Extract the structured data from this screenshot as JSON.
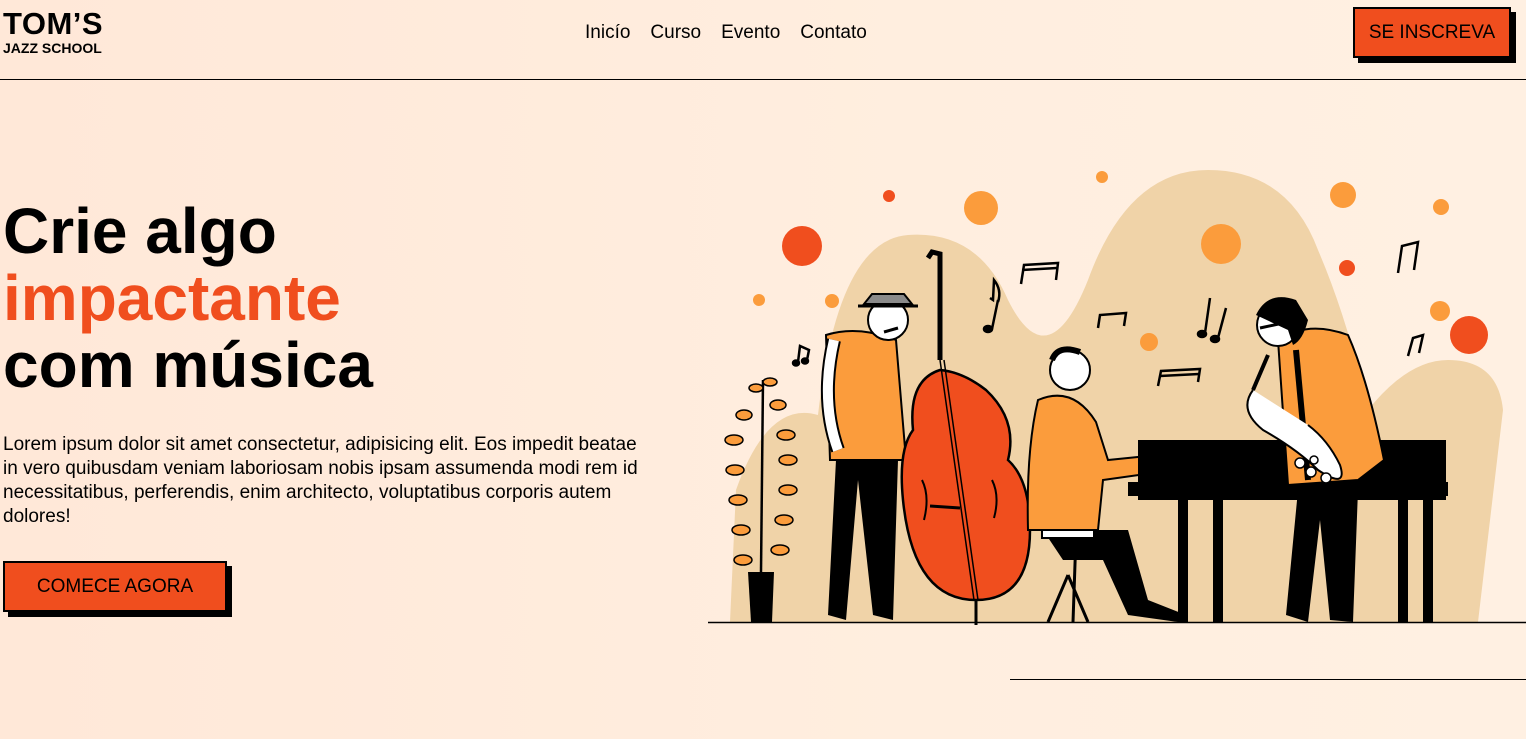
{
  "header": {
    "logo": {
      "line1": "TOM’S",
      "line2": "JAZZ SCHOOL"
    },
    "nav": [
      {
        "label": "Inicío"
      },
      {
        "label": "Curso"
      },
      {
        "label": "Evento"
      },
      {
        "label": "Contato"
      }
    ],
    "signup_label": "SE INSCREVA"
  },
  "hero": {
    "title_line1": "Crie algo",
    "title_line2": "impactante",
    "title_line3": "com música",
    "description": "Lorem ipsum dolor sit amet consectetur, adipisicing elit. Eos impedit beatae in vero quibusdam veniam laboriosam nobis ipsam assumenda modi rem id necessitatibus, perferendis, enim architecto, voluptatibus corporis autem dolores!",
    "cta_label": "COMECE AGORA"
  },
  "colors": {
    "accent": "#f04e1e",
    "orange_light": "#fb9c3c",
    "blob": "#f0d3a8",
    "background": "#ffeddd"
  },
  "icons": [
    "jazz-band-illustration",
    "music-note-icon",
    "plant-icon"
  ]
}
